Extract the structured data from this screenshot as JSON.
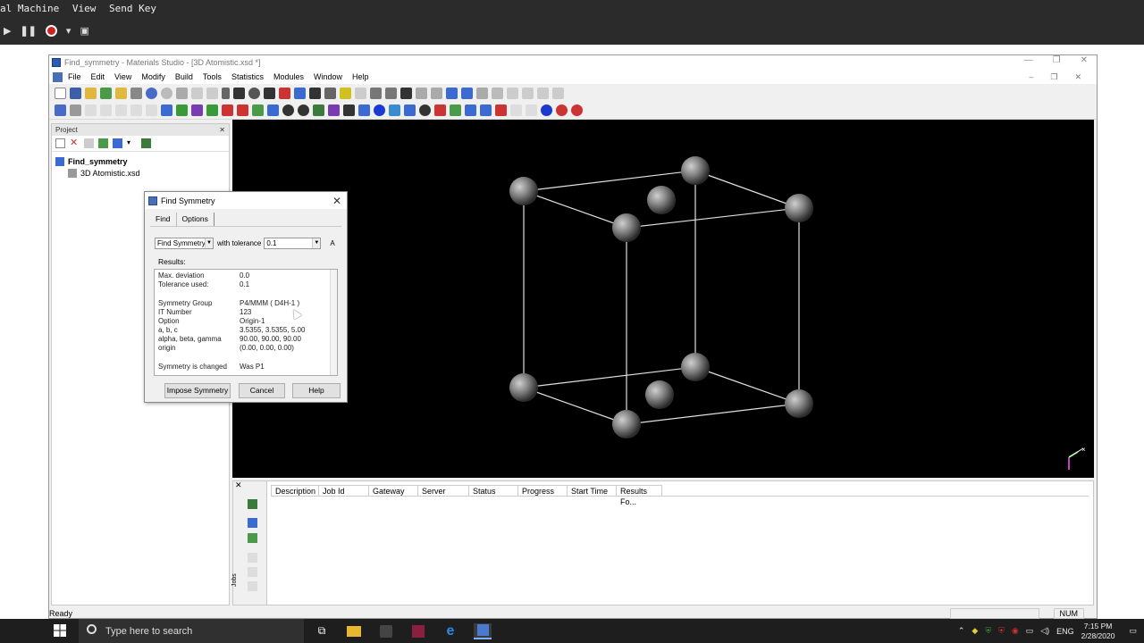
{
  "vm": {
    "menu": [
      "al Machine",
      "View",
      "Send Key"
    ]
  },
  "window": {
    "title": "Find_symmetry - Materials Studio - [3D Atomistic.xsd *]"
  },
  "menu": [
    "File",
    "Edit",
    "View",
    "Modify",
    "Build",
    "Tools",
    "Statistics",
    "Modules",
    "Window",
    "Help"
  ],
  "project": {
    "header": "Project",
    "root": "Find_symmetry",
    "child": "3D Atomistic.xsd"
  },
  "dialog": {
    "title": "Find Symmetry",
    "tabs": [
      "Find",
      "Options"
    ],
    "mode": "Find Symmetry",
    "tolerance_label": "with tolerance",
    "tolerance": "0.1",
    "unit": "A",
    "results_label": "Results:",
    "results": [
      {
        "k": "Max. deviation",
        "v": "0.0"
      },
      {
        "k": "Tolerance used:",
        "v": "0.1"
      },
      {
        "k": "Symmetry Group",
        "v": "P4/MMM  ( D4H-1 )"
      },
      {
        "k": "IT Number",
        "v": "123"
      },
      {
        "k": "Option",
        "v": "Origin-1"
      },
      {
        "k": "a, b, c",
        "v": "3.5355,  3.5355,  5.00"
      },
      {
        "k": "alpha, beta, gamma",
        "v": "90.00,  90.00,  90.00"
      },
      {
        "k": "origin",
        "v": "(0.00,  0.00,  0.00)"
      },
      {
        "k": "Symmetry is changed",
        "v": "Was P1"
      }
    ],
    "buttons": {
      "impose": "Impose Symmetry",
      "cancel": "Cancel",
      "help": "Help"
    }
  },
  "jobs": {
    "columns": [
      "Description",
      "Job Id",
      "Gateway",
      "Server",
      "Status",
      "Progress",
      "Start Time",
      "Results Fo..."
    ],
    "side_label": "Jobs"
  },
  "status": {
    "left": "Ready",
    "num": "NUM"
  },
  "taskbar": {
    "search_placeholder": "Type here to search",
    "lang": "ENG",
    "time": "7:15 PM",
    "date": "2/28/2020"
  }
}
